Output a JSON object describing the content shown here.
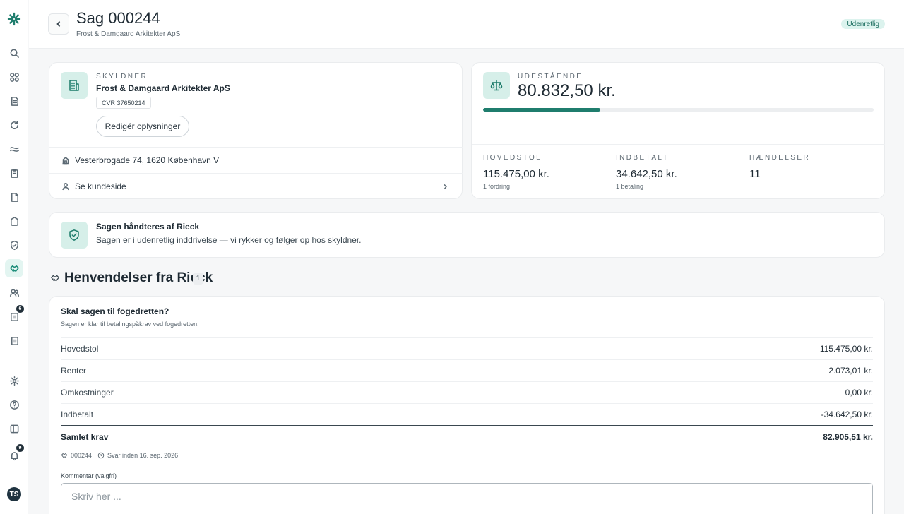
{
  "sidebar": {
    "notification_badge": "9",
    "inbox_badge": "6",
    "avatar_initials": "TS"
  },
  "header": {
    "title": "Sag 000244",
    "subtitle": "Frost & Damgaard Arkitekter ApS",
    "status": "Udenretlig"
  },
  "debtor": {
    "label": "SKYLDNER",
    "name": "Frost & Damgaard Arkitekter ApS",
    "cvr": "CVR 37650214",
    "edit_label": "Redigér oplysninger",
    "address": "Vesterbrogade 74, 1620 København V",
    "customer_link": "Se kundeside"
  },
  "outstanding": {
    "label": "UDESTÅENDE",
    "amount": "80.832,50 kr.",
    "progress_fraction": 0.3,
    "stats": [
      {
        "label": "HOVEDSTOL",
        "value": "115.475,00 kr.",
        "sub": "1 fordring"
      },
      {
        "label": "INDBETALT",
        "value": "34.642,50 kr.",
        "sub": "1 betaling"
      },
      {
        "label": "HÆNDELSER",
        "value": "11",
        "sub": ""
      }
    ]
  },
  "handled": {
    "title": "Sagen håndteres af Rieck",
    "text": "Sagen er i udenretlig inddrivelse — vi rykker og følger op hos skyldner."
  },
  "inquiries": {
    "title": "Henvendelser fra Rieck",
    "count": "1",
    "item": {
      "title": "Skal sagen til fogedretten?",
      "subtitle": "Sagen er klar til betalingspåkrav ved fogedretten.",
      "lines": [
        {
          "label": "Hovedstol",
          "amount": "115.475,00 kr."
        },
        {
          "label": "Renter",
          "amount": "2.073,01 kr."
        },
        {
          "label": "Omkostninger",
          "amount": "0,00 kr."
        },
        {
          "label": "Indbetalt",
          "amount": "-34.642,50 kr."
        }
      ],
      "total_label": "Samlet krav",
      "total_amount": "82.905,51 kr.",
      "case_ref": "000244",
      "deadline": "Svar inden 16. sep. 2026",
      "comment_label": "Kommentar (valgfri)",
      "comment_placeholder": "Skriv her ..."
    }
  },
  "colors": {
    "accent": "#1f7d6d",
    "accent_soft": "#d6efe9",
    "status_bg": "#dcf3ee"
  }
}
